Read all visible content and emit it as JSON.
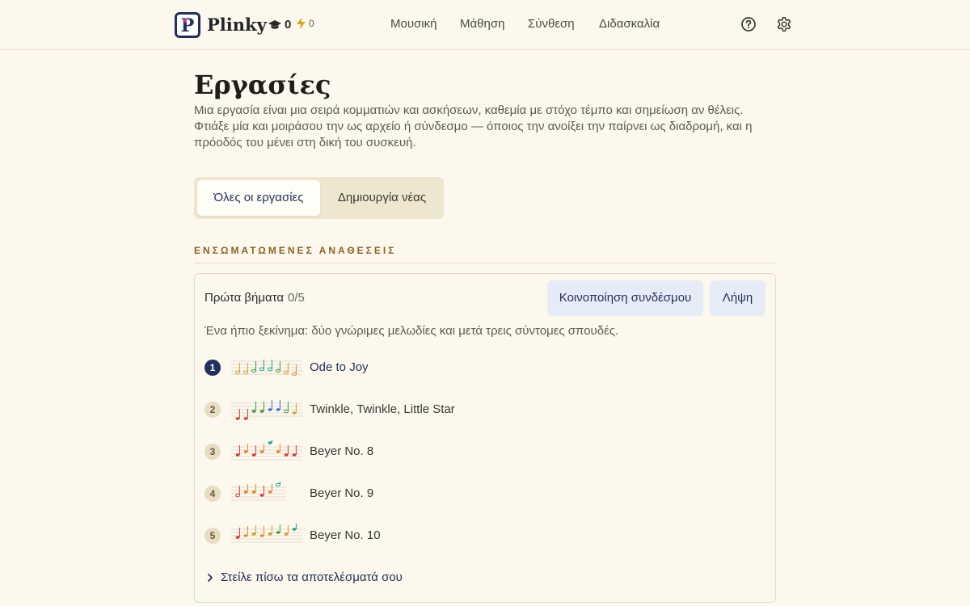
{
  "header": {
    "brand": "Plinky",
    "logo_letter": "P",
    "scholar_count": "0",
    "energy_count": "0",
    "nav": [
      "Μουσική",
      "Μάθηση",
      "Σύνθεση",
      "Διδασκαλία"
    ]
  },
  "page": {
    "title": "Εργασίες",
    "intro": "Μια εργασία είναι μια σειρά κομματιών και ασκήσεων, καθεμία με στόχο τέμπο και σημείωση αν θέλεις. Φτιάξε μία και μοιράσου την ως αρχείο ή σύνδεσμο — όποιος την ανοίξει την παίρνει ως διαδρομή, και η πρόοδός του μένει στη δική του συσκευή."
  },
  "tabs": {
    "all": "Όλες οι εργασίες",
    "new": "Δημιουργία νέας"
  },
  "section": {
    "heading": "ΕΝΣΩΜΑΤΩΜΕΝΕΣ ΑΝΑΘΕΣΕΙΣ"
  },
  "assignment": {
    "title": "Πρώτα βήματα",
    "progress": "0/5",
    "share_label": "Κοινοποίηση συνδέσμου",
    "download_label": "Λήψη",
    "description": "Ένα ήπιο ξεκίνημα: δύο γνώριμες μελωδίες και μετά τρεις σύντομες σπουδές.",
    "items": [
      {
        "num": "1",
        "title": "Ode to Joy"
      },
      {
        "num": "2",
        "title": "Twinkle, Twinkle, Little Star"
      },
      {
        "num": "3",
        "title": "Beyer No. 8"
      },
      {
        "num": "4",
        "title": "Beyer No. 9"
      },
      {
        "num": "5",
        "title": "Beyer No. 10"
      }
    ],
    "send_back_label": "Στείλε πίσω τα αποτελέσματά σου"
  },
  "colors": {
    "accent": "#232f5c",
    "background": "#fdf8ee",
    "section_heading": "#8a6424",
    "note_red": "#d8383b",
    "note_orange": "#e2892a",
    "note_yellow": "#c9a526",
    "note_green": "#3d9c3a",
    "note_teal": "#1f9f8f",
    "note_blue": "#3a6fd0"
  }
}
